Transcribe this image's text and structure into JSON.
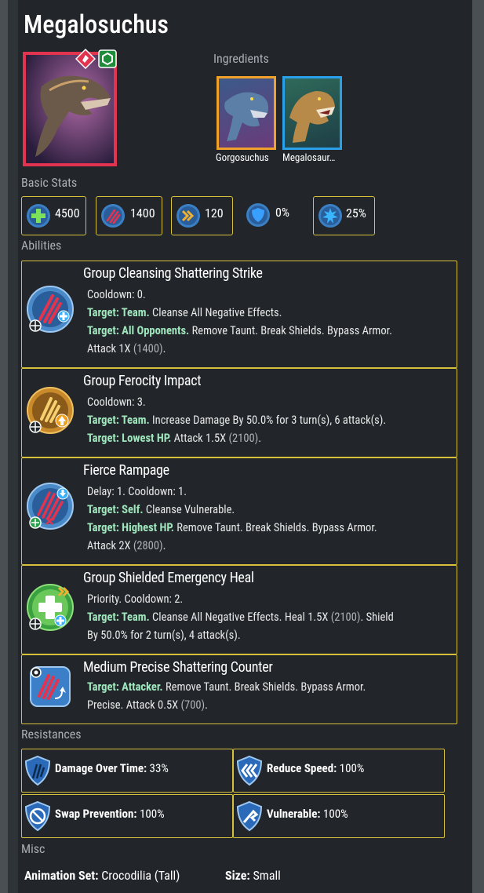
{
  "creature": {
    "name": "Megalosuchus"
  },
  "sections": {
    "ingredients": "Ingredients",
    "basic_stats": "Basic Stats",
    "abilities": "Abilities",
    "resistances": "Resistances",
    "misc": "Misc"
  },
  "ingredients": [
    {
      "name": "Gorgosuchus",
      "frame_color": "#f0a12a"
    },
    {
      "name": "Megalosaur…",
      "frame_color": "#2aa0e8"
    }
  ],
  "stats": [
    {
      "icon": "health-icon",
      "value": "4500"
    },
    {
      "icon": "damage-icon",
      "value": "1400"
    },
    {
      "icon": "speed-icon",
      "value": "120"
    },
    {
      "icon": "armor-icon",
      "value": "0%"
    },
    {
      "icon": "crit-icon",
      "value": "25%"
    }
  ],
  "abilities": [
    {
      "name": "Group Cleansing Shattering Strike",
      "lines": [
        {
          "cooldown": "Cooldown: 0."
        },
        {
          "target": "Target: Team.",
          "text": " Cleanse All Negative Effects."
        },
        {
          "target": "Target: All Opponents.",
          "text": " Remove Taunt. Break Shields. Bypass Armor."
        },
        {
          "text": "Attack 1X ",
          "gray": "(1400)",
          "end": "."
        }
      ]
    },
    {
      "name": "Group Ferocity Impact",
      "lines": [
        {
          "cooldown": "Cooldown: 3."
        },
        {
          "target": "Target: Team.",
          "text": " Increase Damage By 50.0% for 3 turn(s), 6 attack(s)."
        },
        {
          "target": "Target: Lowest HP.",
          "text": " Attack 1.5X ",
          "gray": "(2100)",
          "end": "."
        }
      ]
    },
    {
      "name": "Fierce Rampage",
      "lines": [
        {
          "cooldown": "Delay: 1. Cooldown: 1."
        },
        {
          "target": "Target: Self.",
          "text": " Cleanse Vulnerable."
        },
        {
          "target": "Target: Highest HP.",
          "text": " Remove Taunt. Break Shields. Bypass Armor."
        },
        {
          "text": "Attack 2X ",
          "gray": "(2800)",
          "end": "."
        }
      ]
    },
    {
      "name": "Group Shielded Emergency Heal",
      "lines": [
        {
          "cooldown": "Priority. Cooldown: 2."
        },
        {
          "target": "Target: Team.",
          "text": " Cleanse All Negative Effects. Heal 1.5X ",
          "gray": "(2100)",
          "end": ". Shield"
        },
        {
          "text": "By 50.0% for 2 turn(s), 4 attack(s)."
        }
      ]
    },
    {
      "name": "Medium Precise Shattering Counter",
      "lines": [
        {
          "target": "Target: Attacker.",
          "text": " Remove Taunt. Break Shields. Bypass Armor."
        },
        {
          "text": "Precise. Attack 0.5X ",
          "gray": "(700)",
          "end": "."
        }
      ]
    }
  ],
  "resistances": [
    {
      "icon": "damage-over-time-icon",
      "label": "Damage Over Time:",
      "value": " 33%"
    },
    {
      "icon": "reduce-speed-icon",
      "label": "Reduce Speed:",
      "value": " 100%"
    },
    {
      "icon": "swap-prevention-icon",
      "label": "Swap Prevention:",
      "value": " 100%"
    },
    {
      "icon": "vulnerable-icon",
      "label": "Vulnerable:",
      "value": " 100%"
    }
  ],
  "misc": {
    "animation_label": "Animation Set:",
    "animation_value": " Crocodilia (Tall)",
    "size_label": "Size:",
    "size_value": " Small"
  },
  "colors": {
    "accent_border": "#d7c13a",
    "cooldown": "#e5c539",
    "target": "#9fe6bd",
    "rarity": "#e2344e"
  }
}
